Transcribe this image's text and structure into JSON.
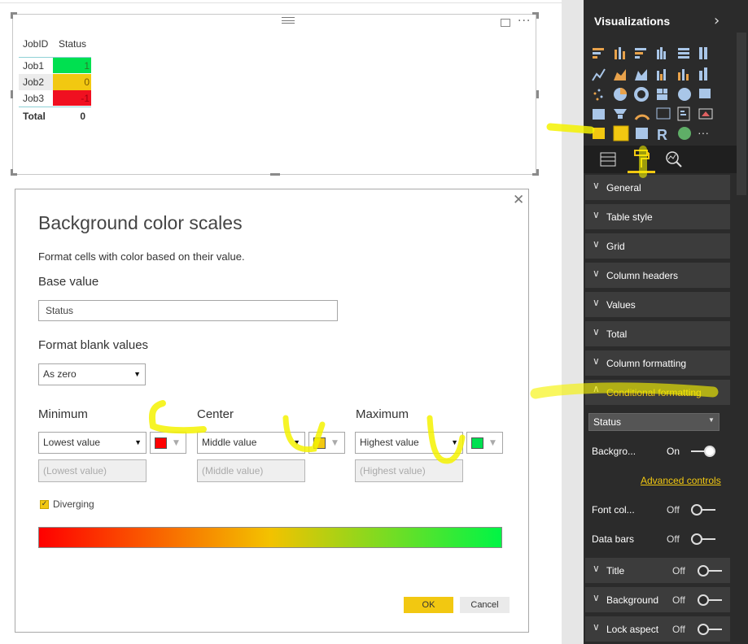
{
  "table": {
    "headers": [
      "JobID",
      "Status"
    ],
    "rows": [
      {
        "job": "Job1",
        "status": "1",
        "color": "#00e050"
      },
      {
        "job": "Job2",
        "status": "0",
        "color": "#f2c811"
      },
      {
        "job": "Job3",
        "status": "-1",
        "color": "#f01020"
      }
    ],
    "total_label": "Total",
    "total_value": "0",
    "more_icon": "···"
  },
  "dialog": {
    "title": "Background color scales",
    "description": "Format cells with color based on their value.",
    "base_value_label": "Base value",
    "base_value": "Status",
    "blank_label": "Format blank values",
    "blank_value": "As zero",
    "minimum": {
      "label": "Minimum",
      "select": "Lowest value",
      "placeholder": "(Lowest value)",
      "color": "#ff0000"
    },
    "center": {
      "label": "Center",
      "select": "Middle value",
      "placeholder": "(Middle value)",
      "color": "#f2c811"
    },
    "maximum": {
      "label": "Maximum",
      "select": "Highest value",
      "placeholder": "(Highest value)",
      "color": "#00e050"
    },
    "diverging_label": "Diverging",
    "diverging_checked": true,
    "ok_label": "OK",
    "cancel_label": "Cancel"
  },
  "pane": {
    "title": "Visualizations",
    "sections_top": [
      {
        "label": "General"
      },
      {
        "label": "Table style"
      },
      {
        "label": "Grid"
      },
      {
        "label": "Column headers"
      },
      {
        "label": "Values"
      },
      {
        "label": "Total"
      },
      {
        "label": "Column formatting"
      }
    ],
    "conditional": {
      "label": "Conditional formatting",
      "field": "Status",
      "background_label": "Backgro...",
      "background_state": "On",
      "advanced_link": "Advanced controls",
      "font_color_label": "Font col...",
      "font_color_state": "Off",
      "data_bars_label": "Data bars",
      "data_bars_state": "Off"
    },
    "sections_bottom": [
      {
        "label": "Title",
        "state": "Off"
      },
      {
        "label": "Background",
        "state": "Off"
      },
      {
        "label": "Lock aspect",
        "state": "Off"
      }
    ],
    "accent": "#f2c811"
  }
}
